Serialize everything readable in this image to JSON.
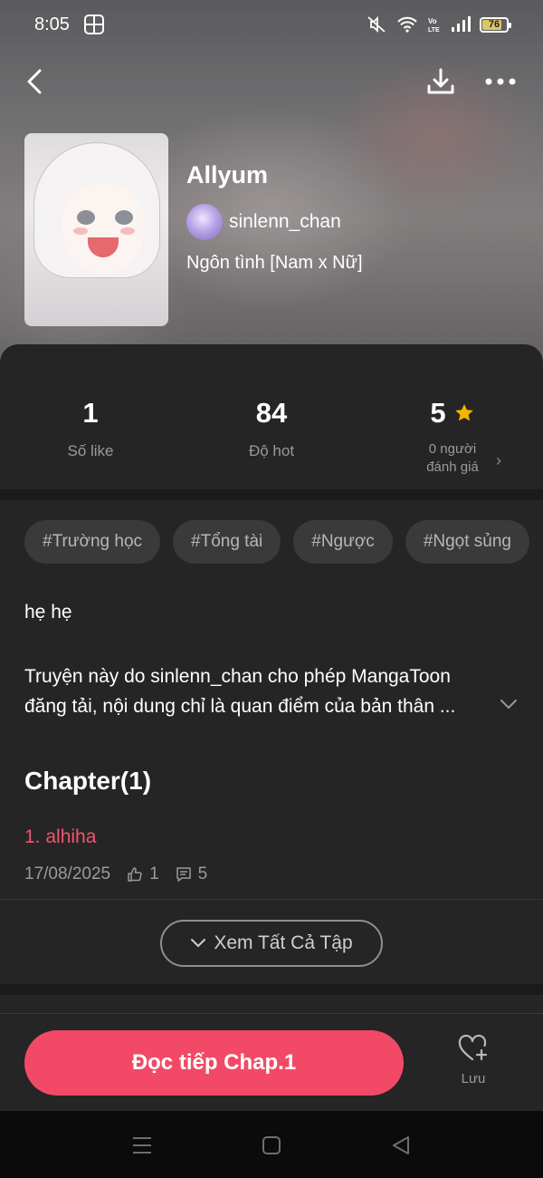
{
  "status_bar": {
    "time": "8:05",
    "battery": "76",
    "battery_level": 0.76
  },
  "story": {
    "title": "Allyum",
    "author": "sinlenn_chan",
    "genre": "Ngôn tình [Nam x Nữ]"
  },
  "stats": {
    "likes": {
      "value": "1",
      "label": "Số like"
    },
    "hot": {
      "value": "84",
      "label": "Độ hot"
    },
    "rating": {
      "value": "5",
      "label_line1": "0 người",
      "label_line2": "đánh giá"
    }
  },
  "tags": [
    "#Trường học",
    "#Tổng tài",
    "#Ngược",
    "#Ngọt sủng"
  ],
  "description": {
    "short": "hẹ hẹ",
    "long": "Truyện này do sinlenn_chan cho phép MangaToon đăng tải, nội dung chỉ là quan điểm của bản thân ..."
  },
  "chapters": {
    "title": "Chapter(1)",
    "items": [
      {
        "name": "1. alhiha",
        "date": "17/08/2025",
        "likes": "1",
        "comments": "5"
      }
    ],
    "view_all_label": "Xem Tất Cả Tập"
  },
  "actions": {
    "read_label": "Đọc tiếp Chap.1",
    "save_label": "Lưu"
  },
  "colors": {
    "accent": "#f24a66",
    "chapter_link": "#f2546f",
    "star": "#f5b400",
    "panel_bg": "#252526"
  },
  "icons": [
    "back-icon",
    "download-icon",
    "more-icon",
    "star-icon",
    "chevron-right-icon",
    "chevron-down-icon",
    "thumbs-up-icon",
    "comment-icon",
    "heart-plus-icon",
    "menu-icon",
    "home-icon",
    "back-triangle-icon"
  ]
}
